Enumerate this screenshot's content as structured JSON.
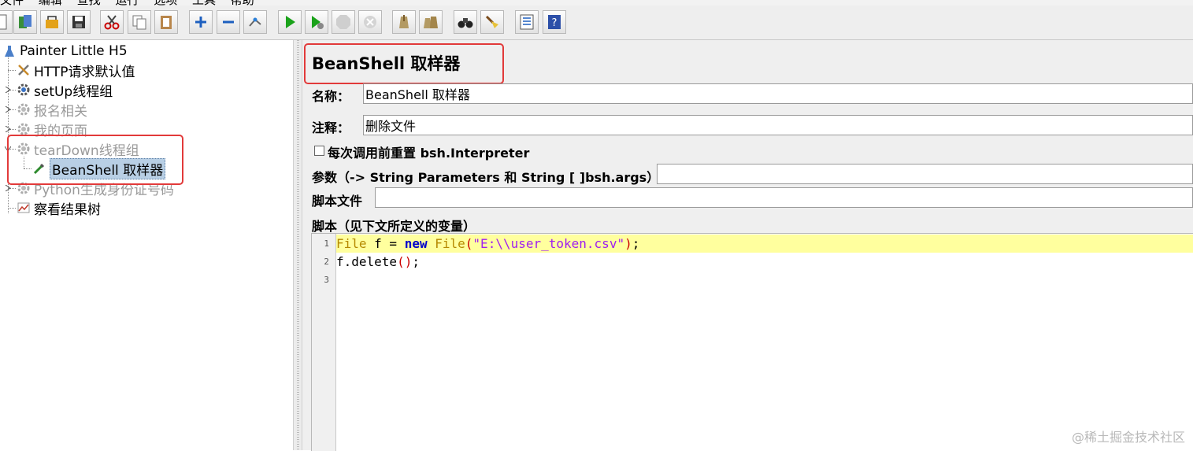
{
  "menu": {
    "items": [
      "文件",
      "编辑",
      "查找",
      "运行",
      "选项",
      "工具",
      "帮助"
    ]
  },
  "toolbar": {
    "buttons": [
      "new-icon",
      "templates-icon",
      "open-icon",
      "save-icon",
      "cut-icon",
      "copy-icon",
      "paste-icon",
      "expand-icon",
      "collapse-icon",
      "toggle-icon",
      "start-icon",
      "start-no-pause-icon",
      "stop-icon",
      "shutdown-icon",
      "clear-icon",
      "clear-all-icon",
      "search-icon",
      "reset-search-icon",
      "function-helper-icon",
      "help-icon"
    ]
  },
  "tree": {
    "root": "Painter Little H5",
    "items": [
      {
        "label": "HTTP请求默认值",
        "disabled": false
      },
      {
        "label": "setUp线程组",
        "disabled": false
      },
      {
        "label": "报名相关",
        "disabled": true
      },
      {
        "label": "我的页面",
        "disabled": true
      },
      {
        "label": "tearDown线程组",
        "disabled": true
      },
      {
        "label": "BeanShell 取样器",
        "selected": true
      },
      {
        "label": "Python生成身份证号码",
        "disabled": true
      },
      {
        "label": "察看结果树",
        "disabled": false
      }
    ]
  },
  "panel": {
    "title": "BeanShell 取样器",
    "name_label": "名称：",
    "name_value": "BeanShell 取样器",
    "comment_label": "注释：",
    "comment_value": "删除文件",
    "reset_label": "每次调用前重置 bsh.Interpreter",
    "reset_checked": false,
    "params_label": "参数（-> String Parameters 和 String [ ]bsh.args）",
    "params_value": "",
    "script_file_label": "脚本文件",
    "script_file_value": "",
    "script_label": "脚本（见下文所定义的变量）"
  },
  "editor": {
    "line_numbers": [
      "1",
      "2",
      "3"
    ],
    "lines": [
      [
        "File",
        " f = ",
        "new",
        " ",
        "File",
        "(",
        "\"E:\\\\user_token.csv\"",
        ")",
        ";"
      ],
      [
        "f.delete",
        "()",
        ";"
      ],
      []
    ]
  },
  "watermark": "@稀土掘金技术社区",
  "colors": {
    "highlight_box": "#e23a3a",
    "active_line": "#ffff9e",
    "selection": "#b8cfe5"
  }
}
